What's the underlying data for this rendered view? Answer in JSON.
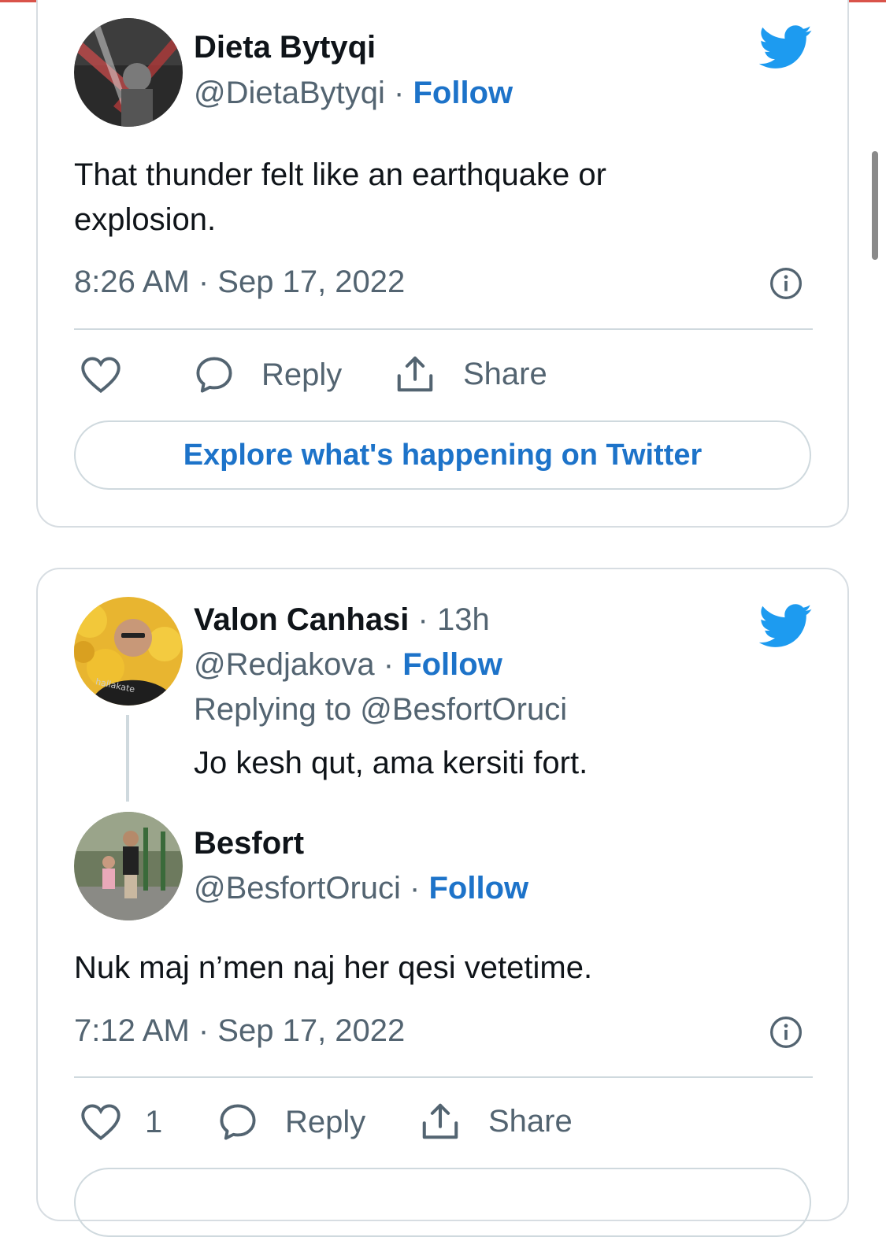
{
  "tweet1": {
    "name": "Dieta Bytyqi",
    "handle": "@DietaBytyqi",
    "separator": "·",
    "follow_label": "Follow",
    "text_line1": "That thunder felt like an earthquake or",
    "text_line2": "explosion.",
    "timestamp": "8:26 AM · Sep 17, 2022",
    "actions": {
      "reply_label": "Reply",
      "share_label": "Share"
    },
    "explore_label": "Explore what's happening on Twitter"
  },
  "tweet2": {
    "reply": {
      "name": "Valon Canhasi",
      "time_ago": "· 13h",
      "handle": "@Redjakova",
      "separator": "·",
      "follow_label": "Follow",
      "replying_to": "Replying to @BesfortOruci",
      "text": "Jo kesh qut, ama kersiti fort."
    },
    "quoted": {
      "name": "Besfort",
      "handle": "@BesfortOruci",
      "separator": "·",
      "follow_label": "Follow",
      "text": "Nuk maj n’men naj her qesi vetetime.",
      "timestamp": "7:12 AM · Sep 17, 2022"
    },
    "actions": {
      "like_count": "1",
      "reply_label": "Reply",
      "share_label": "Share"
    }
  },
  "colors": {
    "accent": "#1d73c9",
    "twitter_blue": "#1d9bf0",
    "muted_text": "#536471",
    "border": "#d7dde2"
  },
  "icons": [
    "twitter-bird-icon",
    "info-icon",
    "heart-icon",
    "reply-bubble-icon",
    "share-icon"
  ]
}
